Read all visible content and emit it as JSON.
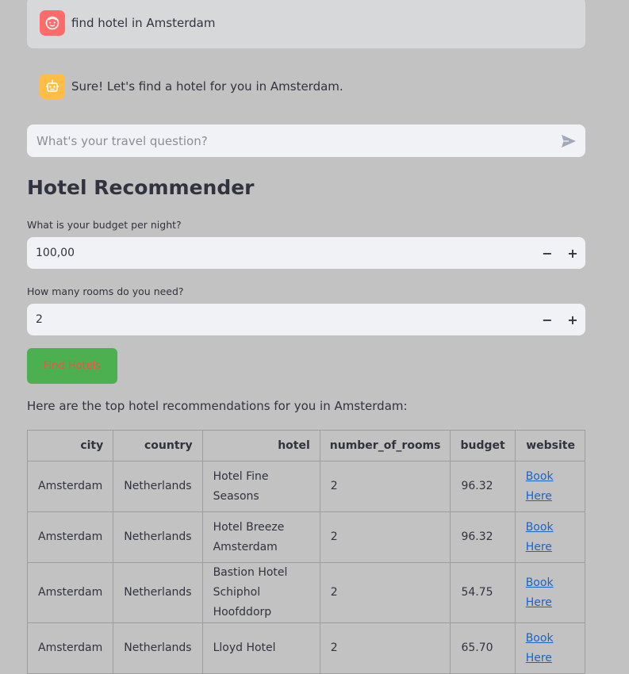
{
  "chat": {
    "user_message": "find hotel in Amsterdam",
    "assistant_message": "Sure! Let's find a hotel for you in Amsterdam.",
    "input_placeholder": "What's your travel question?"
  },
  "recommender": {
    "title": "Hotel Recommender",
    "budget_label": "What is your budget per night?",
    "budget_value": "100,00",
    "rooms_label": "How many rooms do you need?",
    "rooms_value": "2",
    "find_button": "Find Hotels",
    "result_text": "Here are the top hotel recommendations for you in Amsterdam:"
  },
  "table": {
    "headers": [
      "city",
      "country",
      "hotel",
      "number_of_rooms",
      "budget",
      "website"
    ],
    "rows": [
      {
        "city": "Amsterdam",
        "country": "Netherlands",
        "hotel": "Hotel Fine Seasons",
        "number_of_rooms": "2",
        "budget": "96.32",
        "website": "Book Here"
      },
      {
        "city": "Amsterdam",
        "country": "Netherlands",
        "hotel": "Hotel Breeze Amsterdam",
        "number_of_rooms": "2",
        "budget": "96.32",
        "website": "Book Here"
      },
      {
        "city": "Amsterdam",
        "country": "Netherlands",
        "hotel": "Bastion Hotel Schiphol Hoofddorp",
        "number_of_rooms": "2",
        "budget": "54.75",
        "website": "Book Here"
      },
      {
        "city": "Amsterdam",
        "country": "Netherlands",
        "hotel": "Lloyd Hotel",
        "number_of_rooms": "2",
        "budget": "65.70",
        "website": "Book Here"
      }
    ]
  },
  "icons": {
    "user_avatar": "user-face-icon",
    "assistant_avatar": "robot-icon",
    "send": "send-icon",
    "decrement": "minus-icon",
    "increment": "plus-icon"
  },
  "colors": {
    "background": "#c2c2c2",
    "user_avatar": "#ff6b6b",
    "assistant_avatar": "#ffbd45",
    "find_button_bg": "#4caf50",
    "find_button_text": "#ff4b4b",
    "link": "#1c63c7"
  }
}
